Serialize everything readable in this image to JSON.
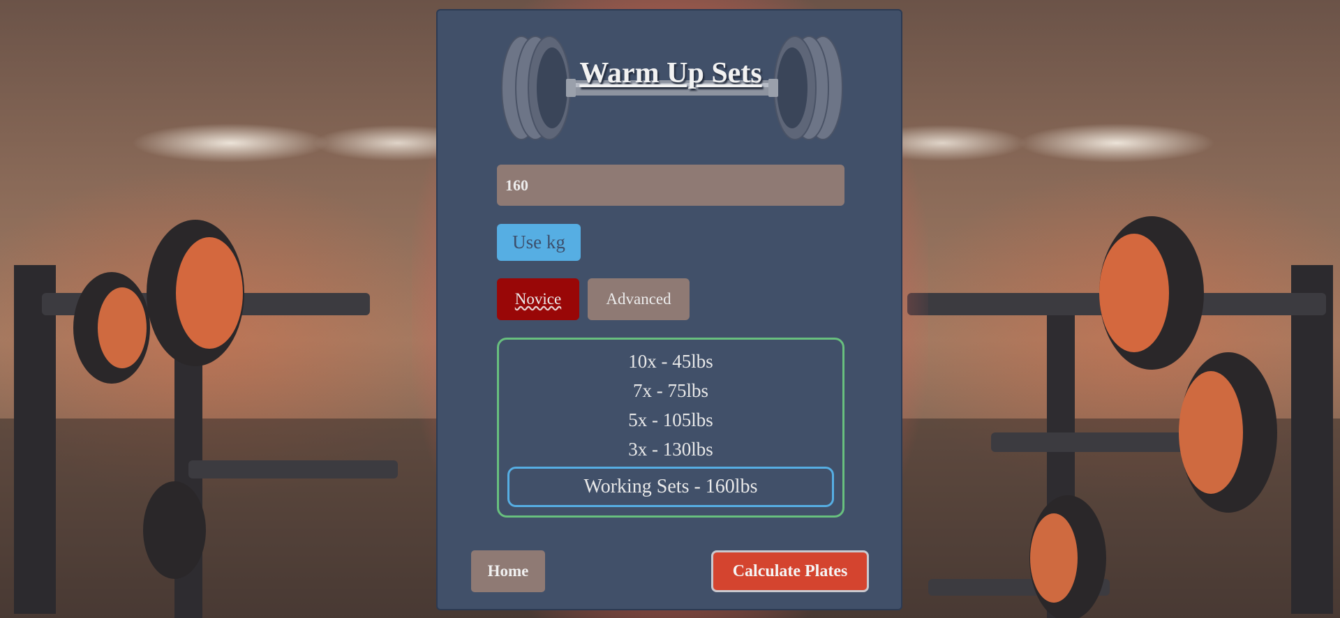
{
  "page": {
    "title": "Warm Up Sets",
    "weight_value": "160",
    "unit_toggle_label": "Use kg",
    "levels": {
      "novice": "Novice",
      "advanced": "Advanced"
    },
    "sets": [
      "10x - 45lbs",
      "7x - 75lbs",
      "5x - 105lbs",
      "3x - 130lbs"
    ],
    "working_sets": "Working Sets - 160lbs",
    "home_label": "Home",
    "calculate_label": "Calculate Plates"
  },
  "colors": {
    "panel": "#415069",
    "accent_blue": "#56aee3",
    "novice_active": "#990707",
    "neutral_button": "#8f7a74",
    "sets_border": "#68c07e",
    "calculate": "#d4442f"
  },
  "icons": {
    "logo": "barbell-icon"
  }
}
